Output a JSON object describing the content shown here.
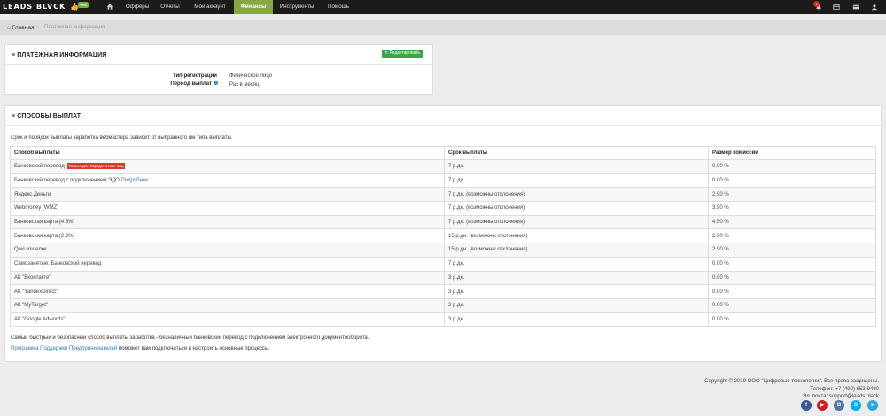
{
  "header": {
    "logo": "LEADS BLVCK",
    "promo_badge": "+5%",
    "nav": [
      {
        "label": "Офферы"
      },
      {
        "label": "Отчеты"
      },
      {
        "label": "Мой аккаунт"
      },
      {
        "label": "Финансы",
        "active": true
      },
      {
        "label": "Инструменты"
      },
      {
        "label": "Помощь"
      }
    ],
    "notification_count": "1"
  },
  "breadcrumb": {
    "home": "Главная",
    "separator": "›",
    "current": "Платежная информация"
  },
  "payment_info": {
    "title": "ПЛАТЕЖНАЯ ИНФОРМАЦИЯ",
    "edit_button": "Редактировать",
    "rows": [
      {
        "label": "Тип регистрации",
        "value": "Физическое лицо"
      },
      {
        "label": "Период выплат",
        "value": "Раз в месяц"
      }
    ]
  },
  "payout_methods": {
    "title": "СПОСОБЫ ВЫПЛАТ",
    "intro": "Срок и порядок выплаты заработка вебмастера зависит от выбранного им типа выплаты.",
    "columns": [
      "Способ выплаты",
      "Срок выплаты",
      "Размер комиссии"
    ],
    "rows": [
      {
        "method": "Банковский перевод",
        "tag": "Только для Юридических лиц",
        "term": "7 р.дн.",
        "fee": "0.00 %"
      },
      {
        "method": "Банковский перевод с подключением ЭДО",
        "link": "Подробнее",
        "term": "7 р.дн.",
        "fee": "0.00 %"
      },
      {
        "method": "Яндекс.Деньги",
        "term": "7 р.дн. (возможны отклонения)",
        "fee": "2.90 %"
      },
      {
        "method": "Webmoney (WMZ)",
        "term": "7 р.дн. (возможны отклонения)",
        "fee": "3.90 %"
      },
      {
        "method": "Банковская карта (4.5%)",
        "term": "7 р.дн. (возможны отклонения)",
        "fee": "4.50 %"
      },
      {
        "method": "Банковская карта (2.9%)",
        "term": "15 р.дн. (возможны отклонения)",
        "fee": "2.90 %"
      },
      {
        "method": "Qiwi кошелек",
        "term": "15 р.дн. (возможны отклонения)",
        "fee": "2.90 %"
      },
      {
        "method": "Самозанятые. Банковский перевод",
        "term": "7 р.дн.",
        "fee": "0.00 %"
      },
      {
        "method": "АК \"Вконтакте\"",
        "term": "3 р.дн.",
        "fee": "0.00 %"
      },
      {
        "method": "АК \"YandexDirect\"",
        "term": "3 р.дн.",
        "fee": "0.00 %"
      },
      {
        "method": "АК \"MyTarget\"",
        "term": "3 р.дн.",
        "fee": "0.00 %"
      },
      {
        "method": "АК \"Google Adwords\"",
        "term": "3 р.дн.",
        "fee": "0.00 %"
      }
    ],
    "note1": "Самый быстрый и безопасный способ выплаты заработка - безналичный банковский перевод с подключением электронного документооборота.",
    "note2_link": "Программа Поддержки Предпринимателей",
    "note2_text": " поможет вам подключиться и настроить основные процессы."
  },
  "footer": {
    "copyright": "Copyright © 2019 ООО \"Цифровые технологии\". Все права защищены.",
    "phone": "Телефон: +7 (499) 653-9480",
    "email": "Эл. почта: support@leads.black",
    "social": [
      {
        "icon": "facebook-icon",
        "glyph": "f",
        "color": "#3b5998"
      },
      {
        "icon": "youtube-icon",
        "glyph": "▶",
        "color": "#cd201f"
      },
      {
        "icon": "vk-icon",
        "glyph": "B",
        "color": "#4a76a8"
      },
      {
        "icon": "skype-icon",
        "glyph": "S",
        "color": "#00aff0"
      },
      {
        "icon": "telegram-icon",
        "glyph": "➤",
        "color": "#2ca5e0"
      }
    ]
  }
}
